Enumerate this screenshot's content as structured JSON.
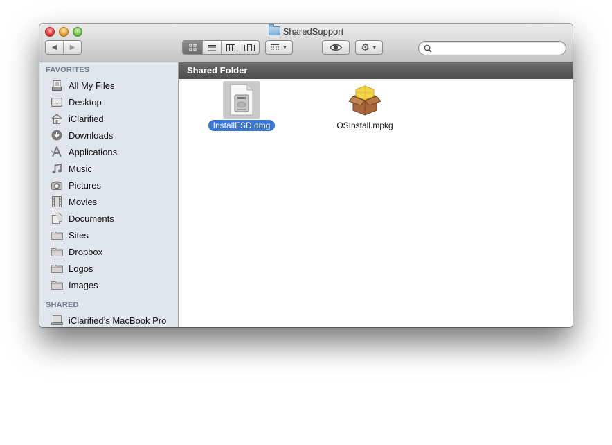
{
  "window": {
    "title": "SharedSupport",
    "title_icon": "folder-icon"
  },
  "toolbar": {
    "back_icon": "back-arrow-icon",
    "forward_icon": "forward-arrow-icon",
    "view_modes": [
      {
        "name": "icon-view",
        "icon": "grid-icon",
        "active": true
      },
      {
        "name": "list-view",
        "icon": "list-icon",
        "active": false
      },
      {
        "name": "column-view",
        "icon": "columns-icon",
        "active": false
      },
      {
        "name": "cover-flow-view",
        "icon": "coverflow-icon",
        "active": false
      }
    ],
    "arrange_icon": "arrange-icon",
    "quicklook_icon": "eye-icon",
    "action_icon": "gear-icon",
    "search": {
      "value": "",
      "placeholder": ""
    }
  },
  "sidebar": {
    "favorites_header": "FAVORITES",
    "favorites": [
      {
        "label": "All My Files",
        "icon": "all-files-icon"
      },
      {
        "label": "Desktop",
        "icon": "desktop-icon"
      },
      {
        "label": "iClarified",
        "icon": "home-icon"
      },
      {
        "label": "Downloads",
        "icon": "downloads-icon"
      },
      {
        "label": "Applications",
        "icon": "applications-icon"
      },
      {
        "label": "Music",
        "icon": "music-icon"
      },
      {
        "label": "Pictures",
        "icon": "camera-icon"
      },
      {
        "label": "Movies",
        "icon": "film-icon"
      },
      {
        "label": "Documents",
        "icon": "documents-icon"
      },
      {
        "label": "Sites",
        "icon": "folder-icon"
      },
      {
        "label": "Dropbox",
        "icon": "folder-icon"
      },
      {
        "label": "Logos",
        "icon": "folder-icon"
      },
      {
        "label": "Images",
        "icon": "folder-icon"
      }
    ],
    "shared_header": "SHARED",
    "shared": [
      {
        "label": "iClarified’s MacBook Pro",
        "icon": "laptop-icon"
      }
    ]
  },
  "pathbar": {
    "title": "Shared Folder"
  },
  "files": [
    {
      "name": "InstallESD.dmg",
      "icon": "disk-image-icon",
      "selected": true
    },
    {
      "name": "OSInstall.mpkg",
      "icon": "package-icon",
      "selected": false
    }
  ]
}
